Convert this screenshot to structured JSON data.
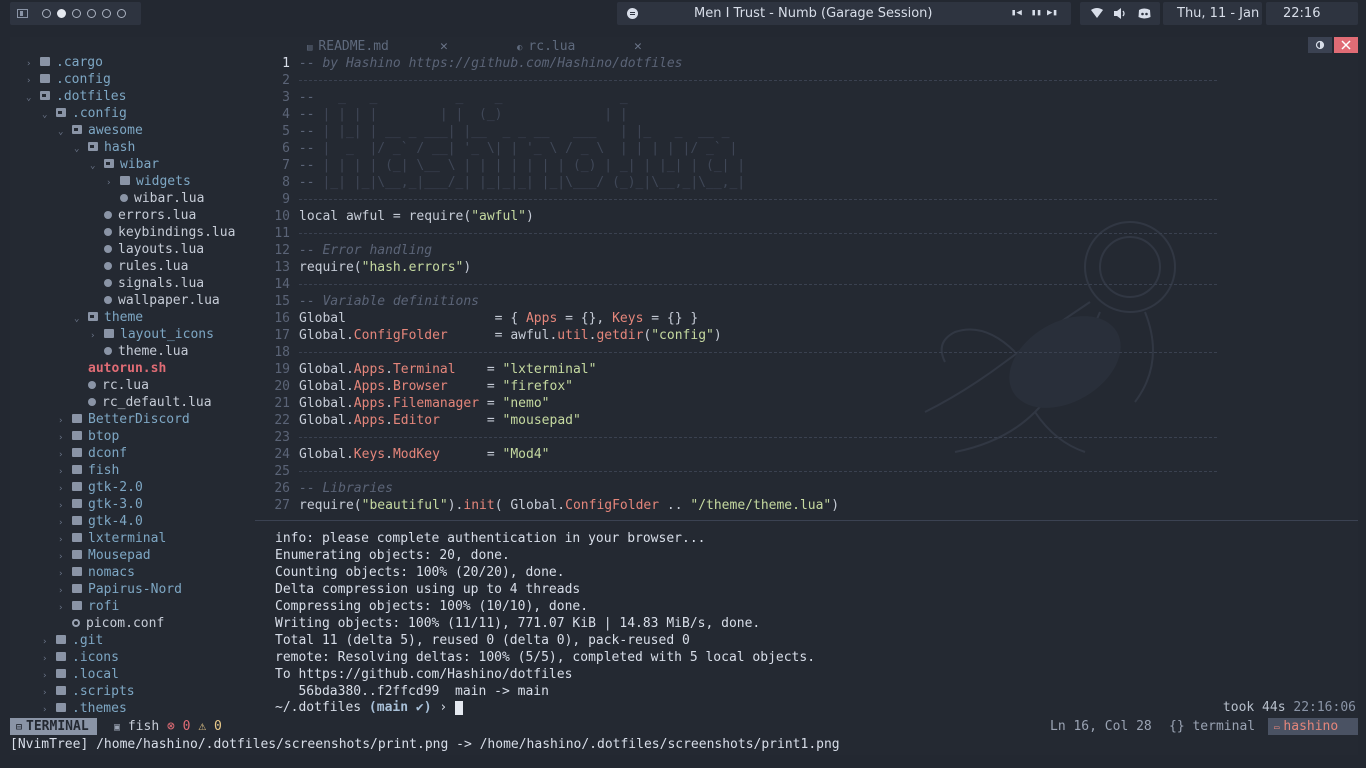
{
  "topbar": {
    "music": {
      "title": "Men I Trust - Numb (Garage Session)"
    },
    "date": "Thu, 11 - Jan",
    "time": "22:16"
  },
  "tree": {
    "items": [
      {
        "label": ".cargo",
        "indent": 0,
        "type": "folder",
        "state": "closed"
      },
      {
        "label": ".config",
        "indent": 0,
        "type": "folder",
        "state": "closed"
      },
      {
        "label": ".dotfiles",
        "indent": 0,
        "type": "folder",
        "state": "open"
      },
      {
        "label": ".config",
        "indent": 1,
        "type": "folder",
        "state": "open"
      },
      {
        "label": "awesome",
        "indent": 2,
        "type": "folder",
        "state": "open"
      },
      {
        "label": "hash",
        "indent": 3,
        "type": "folder",
        "state": "open"
      },
      {
        "label": "wibar",
        "indent": 4,
        "type": "folder",
        "state": "open"
      },
      {
        "label": "widgets",
        "indent": 5,
        "type": "folder",
        "state": "closed"
      },
      {
        "label": "wibar.lua",
        "indent": 5,
        "type": "file"
      },
      {
        "label": "errors.lua",
        "indent": 4,
        "type": "file"
      },
      {
        "label": "keybindings.lua",
        "indent": 4,
        "type": "file"
      },
      {
        "label": "layouts.lua",
        "indent": 4,
        "type": "file"
      },
      {
        "label": "rules.lua",
        "indent": 4,
        "type": "file"
      },
      {
        "label": "signals.lua",
        "indent": 4,
        "type": "file"
      },
      {
        "label": "wallpaper.lua",
        "indent": 4,
        "type": "file"
      },
      {
        "label": "theme",
        "indent": 3,
        "type": "folder",
        "state": "open"
      },
      {
        "label": "layout_icons",
        "indent": 4,
        "type": "folder",
        "state": "closed"
      },
      {
        "label": "theme.lua",
        "indent": 4,
        "type": "file"
      },
      {
        "label": "autorun.sh",
        "indent": 3,
        "type": "file",
        "bold": true
      },
      {
        "label": "rc.lua",
        "indent": 3,
        "type": "file"
      },
      {
        "label": "rc_default.lua",
        "indent": 3,
        "type": "file"
      },
      {
        "label": "BetterDiscord",
        "indent": 2,
        "type": "folder",
        "state": "closed"
      },
      {
        "label": "btop",
        "indent": 2,
        "type": "folder",
        "state": "closed"
      },
      {
        "label": "dconf",
        "indent": 2,
        "type": "folder",
        "state": "closed"
      },
      {
        "label": "fish",
        "indent": 2,
        "type": "folder",
        "state": "closed"
      },
      {
        "label": "gtk-2.0",
        "indent": 2,
        "type": "folder",
        "state": "closed"
      },
      {
        "label": "gtk-3.0",
        "indent": 2,
        "type": "folder",
        "state": "closed"
      },
      {
        "label": "gtk-4.0",
        "indent": 2,
        "type": "folder",
        "state": "closed"
      },
      {
        "label": "lxterminal",
        "indent": 2,
        "type": "folder",
        "state": "closed"
      },
      {
        "label": "Mousepad",
        "indent": 2,
        "type": "folder",
        "state": "closed"
      },
      {
        "label": "nomacs",
        "indent": 2,
        "type": "folder",
        "state": "closed"
      },
      {
        "label": "Papirus-Nord",
        "indent": 2,
        "type": "folder",
        "state": "closed"
      },
      {
        "label": "rofi",
        "indent": 2,
        "type": "folder",
        "state": "closed"
      },
      {
        "label": "picom.conf",
        "indent": 2,
        "type": "gear"
      },
      {
        "label": ".git",
        "indent": 1,
        "type": "folder",
        "state": "closed"
      },
      {
        "label": ".icons",
        "indent": 1,
        "type": "folder",
        "state": "closed"
      },
      {
        "label": ".local",
        "indent": 1,
        "type": "folder",
        "state": "closed"
      },
      {
        "label": ".scripts",
        "indent": 1,
        "type": "folder",
        "state": "closed"
      },
      {
        "label": ".themes",
        "indent": 1,
        "type": "folder",
        "state": "closed"
      }
    ]
  },
  "tabs": [
    {
      "label": "README.md",
      "close": "✕"
    },
    {
      "label": "rc.lua",
      "close": "✕"
    }
  ],
  "editor": {
    "lines": [
      {
        "n": "1",
        "segs": [
          [
            "cm",
            "-- by Hashino https://github.com/Hashino/dotfiles"
          ]
        ]
      },
      {
        "n": "2",
        "rule": true
      },
      {
        "n": "3",
        "segs": [
          [
            "cm",
            "-- "
          ],
          [
            "art",
            "  _   _          _    _               _"
          ]
        ]
      },
      {
        "n": "4",
        "segs": [
          [
            "cm",
            "-- "
          ],
          [
            "art",
            "| | | |        | |  (_)             | |"
          ]
        ]
      },
      {
        "n": "5",
        "segs": [
          [
            "cm",
            "-- "
          ],
          [
            "art",
            "| |_| | __ _ ___| |__  _ _ __   ___   | |_   _  __ _"
          ]
        ]
      },
      {
        "n": "6",
        "segs": [
          [
            "cm",
            "-- "
          ],
          [
            "art",
            "|  _  |/ _` / __| '_ \\| | '_ \\ / _ \\  | | | | |/ _` |"
          ]
        ]
      },
      {
        "n": "7",
        "segs": [
          [
            "cm",
            "-- "
          ],
          [
            "art",
            "| | | | (_| \\__ \\ | | | | | | | (_) | _| | |_| | (_| |"
          ]
        ]
      },
      {
        "n": "8",
        "segs": [
          [
            "cm",
            "-- "
          ],
          [
            "art",
            "|_| |_|\\__,_|___/_| |_|_|_| |_|\\___/ (_)_|\\__,_|\\__,_|"
          ]
        ]
      },
      {
        "n": "9",
        "rule": true
      },
      {
        "n": "10",
        "segs": [
          [
            "k",
            "local awful = require("
          ],
          [
            "str",
            "\"awful\""
          ],
          [
            "k",
            ")"
          ]
        ]
      },
      {
        "n": "11",
        "rule": true
      },
      {
        "n": "12",
        "segs": [
          [
            "cm",
            "-- Error handling"
          ]
        ]
      },
      {
        "n": "13",
        "segs": [
          [
            "k",
            "require("
          ],
          [
            "str",
            "\"hash.errors\""
          ],
          [
            "k",
            ")"
          ]
        ]
      },
      {
        "n": "14",
        "rule": true
      },
      {
        "n": "15",
        "segs": [
          [
            "cm",
            "-- Variable definitions"
          ]
        ]
      },
      {
        "n": "16",
        "segs": [
          [
            "k",
            "Global                   = { "
          ],
          [
            "fld",
            "Apps"
          ],
          [
            "k",
            " = {}, "
          ],
          [
            "fld",
            "Keys"
          ],
          [
            "k",
            " = {} }"
          ]
        ]
      },
      {
        "n": "17",
        "segs": [
          [
            "k",
            "Global."
          ],
          [
            "fld",
            "ConfigFolder"
          ],
          [
            "k",
            "      = awful."
          ],
          [
            "fld",
            "util"
          ],
          [
            "k",
            "."
          ],
          [
            "fld",
            "getdir"
          ],
          [
            "k",
            "("
          ],
          [
            "str",
            "\"config\""
          ],
          [
            "k",
            ")"
          ]
        ]
      },
      {
        "n": "18",
        "rule": true
      },
      {
        "n": "19",
        "segs": [
          [
            "k",
            "Global."
          ],
          [
            "fld",
            "Apps"
          ],
          [
            "k",
            "."
          ],
          [
            "fld",
            "Terminal"
          ],
          [
            "k",
            "    = "
          ],
          [
            "str",
            "\"lxterminal\""
          ]
        ]
      },
      {
        "n": "20",
        "segs": [
          [
            "k",
            "Global."
          ],
          [
            "fld",
            "Apps"
          ],
          [
            "k",
            "."
          ],
          [
            "fld",
            "Browser"
          ],
          [
            "k",
            "     = "
          ],
          [
            "str",
            "\"firefox\""
          ]
        ]
      },
      {
        "n": "21",
        "segs": [
          [
            "k",
            "Global."
          ],
          [
            "fld",
            "Apps"
          ],
          [
            "k",
            "."
          ],
          [
            "fld",
            "Filemanager"
          ],
          [
            "k",
            " = "
          ],
          [
            "str",
            "\"nemo\""
          ]
        ]
      },
      {
        "n": "22",
        "segs": [
          [
            "k",
            "Global."
          ],
          [
            "fld",
            "Apps"
          ],
          [
            "k",
            "."
          ],
          [
            "fld",
            "Editor"
          ],
          [
            "k",
            "      = "
          ],
          [
            "str",
            "\"mousepad\""
          ]
        ]
      },
      {
        "n": "23",
        "rule": true
      },
      {
        "n": "24",
        "segs": [
          [
            "k",
            "Global."
          ],
          [
            "fld",
            "Keys"
          ],
          [
            "k",
            "."
          ],
          [
            "fld",
            "ModKey"
          ],
          [
            "k",
            "      = "
          ],
          [
            "str",
            "\"Mod4\""
          ]
        ]
      },
      {
        "n": "25",
        "rule": true
      },
      {
        "n": "26",
        "segs": [
          [
            "cm",
            "-- Libraries"
          ]
        ]
      },
      {
        "n": "27",
        "segs": [
          [
            "k",
            "require("
          ],
          [
            "str",
            "\"beautiful\""
          ],
          [
            "k",
            ")."
          ],
          [
            "fld",
            "init"
          ],
          [
            "k",
            "( Global."
          ],
          [
            "fld",
            "ConfigFolder"
          ],
          [
            "k",
            " .. "
          ],
          [
            "str",
            "\"/theme/theme.lua\""
          ],
          [
            "k",
            ")"
          ]
        ]
      }
    ]
  },
  "terminal": {
    "lines": [
      "info: please complete authentication in your browser...",
      "Enumerating objects: 20, done.",
      "Counting objects: 100% (20/20), done.",
      "Delta compression using up to 4 threads",
      "Compressing objects: 100% (10/10), done.",
      "Writing objects: 100% (11/11), 771.07 KiB | 14.83 MiB/s, done.",
      "Total 11 (delta 5), reused 0 (delta 0), pack-reused 0",
      "remote: Resolving deltas: 100% (5/5), completed with 5 local objects.",
      "To https://github.com/Hashino/dotfiles",
      "   56bda380..f2ffcd99  main -> main"
    ],
    "prompt_path": "~/.dotfiles",
    "prompt_branch": "(main ✔)",
    "prompt_arrow": "›",
    "took_label": "took 44s",
    "took_time": "22:16:06"
  },
  "status": {
    "mode": "TERMINAL",
    "shell": "fish",
    "errors": "0",
    "warnings": "0",
    "position": "Ln 16, Col 28",
    "filetype": "{} terminal",
    "user": "hashino"
  },
  "cmdline": "[NvimTree] /home/hashino/.dotfiles/screenshots/print.png -> /home/hashino/.dotfiles/screenshots/print1.png",
  "colors": {
    "bg": "#232831",
    "folder": "#7ea7c4",
    "string": "#c5d9a0",
    "field": "#e5867b",
    "comment": "#5b6477",
    "close_button": "#e06c75"
  }
}
